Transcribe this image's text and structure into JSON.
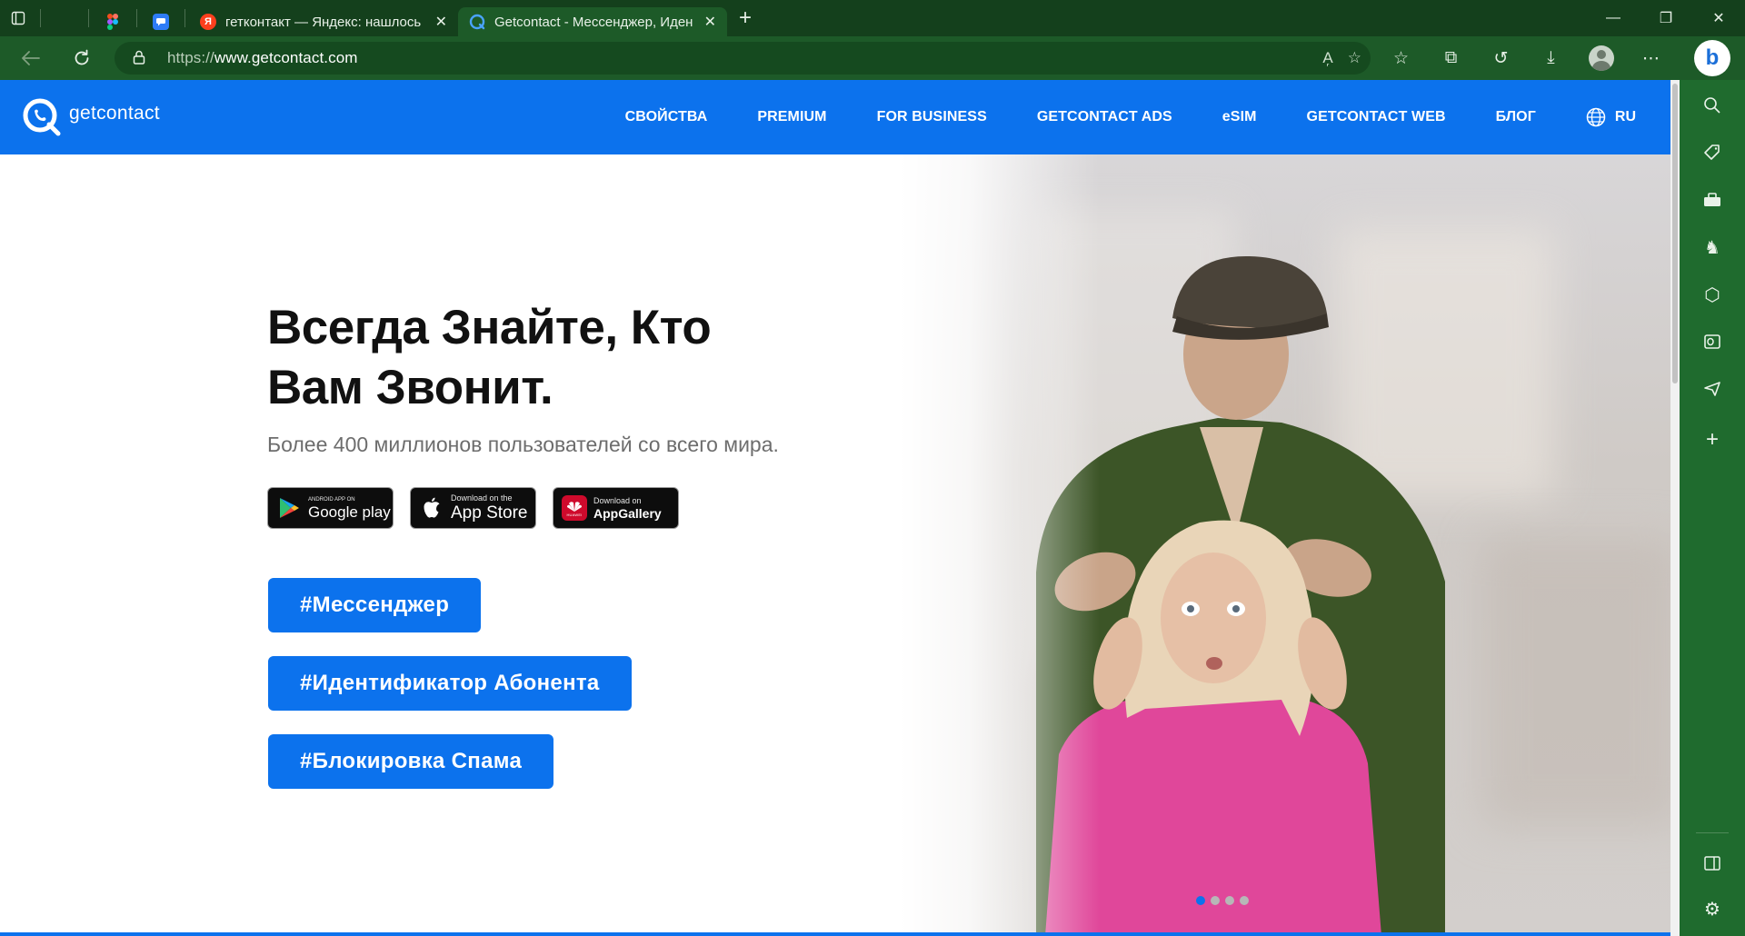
{
  "browser": {
    "tabs": [
      {
        "title": "",
        "favicon": "blank-tab"
      },
      {
        "title": "",
        "favicon": "figma-icon"
      },
      {
        "title": "",
        "favicon": "messages-icon"
      },
      {
        "title": "гетконтакт — Яндекс: нашлось",
        "favicon": "yandex-icon"
      },
      {
        "title": "Getcontact - Мессенджер, Иден",
        "favicon": "getcontact-icon",
        "active": true
      }
    ],
    "address": {
      "protocol": "https://",
      "host": "www.getcontact.com"
    },
    "accent_color": "#14401c"
  },
  "site": {
    "brand": "getcontact",
    "brand_color": "#0c72ed",
    "menu": [
      "СВОЙСТВА",
      "PREMIUM",
      "FOR BUSINESS",
      "GETCONTACT ADS",
      "eSIM",
      "GETCONTACT WEB",
      "БЛОГ"
    ],
    "language": "RU",
    "hero": {
      "title_line1": "Всегда Знайте, Кто",
      "title_line2": "Вам Звонит.",
      "subtitle": "Более 400 миллионов пользователей со всего мира."
    },
    "stores": {
      "google": {
        "small": "ANDROID APP ON",
        "big": "Google play"
      },
      "apple": {
        "small": "Download on the",
        "big": "App Store"
      },
      "huawei": {
        "small": "Download on",
        "big": "AppGallery",
        "badge": "HUAWEI"
      }
    },
    "tags": [
      "#Мессенджер",
      "#Идентификатор Абонента",
      "#Блокировка Спама"
    ],
    "carousel": {
      "slides": 4,
      "active": 1
    }
  }
}
